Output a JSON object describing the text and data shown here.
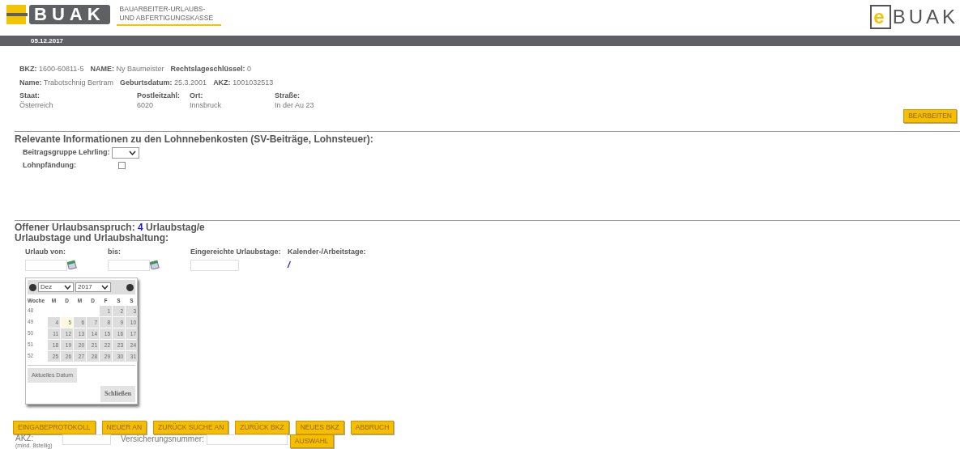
{
  "header": {
    "logo_text": "BUAK",
    "org_line1": "BAUARBEITER-URLAUBS-",
    "org_line2": "UND ABFERTIGUNGSKASSE",
    "ebuak_e": "e",
    "ebuak_text": "BUAK",
    "date": "05.12.2017"
  },
  "info_lines": [
    [
      {
        "label": "BKZ:",
        "value": "1600-60811-5"
      },
      {
        "label": "NAME:",
        "value": "Ny Baumeister"
      },
      {
        "label": "Rechtslageschlüssel:",
        "value": "0"
      }
    ],
    [
      {
        "label": "Name:",
        "value": "Trabotschnig Bertram"
      },
      {
        "label": "Geburtsdatum:",
        "value": "25.3.2001"
      },
      {
        "label": "AKZ:",
        "value": "1001032513"
      }
    ]
  ],
  "address": [
    {
      "label": "Staat:",
      "value": "Österreich"
    },
    {
      "label": "Postleitzahl:",
      "value": "6020"
    },
    {
      "label": "Ort:",
      "value": "Innsbruck"
    },
    {
      "label": "Straße:",
      "value": "In der Au 23"
    }
  ],
  "edit_button": "BEARBEITEN",
  "lohn": {
    "heading": "Relevante Informationen zu den Lohnnebenkosten (SV-Beiträge, Lohnsteuer):",
    "beitrag_label": "Beitragsgruppe Lehrling:",
    "pfaendung_label": "Lohnpfändung:",
    "pfaendung_checked": false
  },
  "urlaub": {
    "open_prefix": "Offener Urlaubsanspruch:",
    "open_days": "4",
    "open_suffix": "Urlaubstag/e",
    "heading": "Urlaubstage und Urlaubshaltung:",
    "von_label": "Urlaub von:",
    "bis_label": "bis:",
    "eingereicht_label": "Eingereichte Urlaubstage:",
    "kalender_label": "Kalender-/Arbeitstage:",
    "kalender_value": "/"
  },
  "calendar": {
    "month": "Dez",
    "year": "2017",
    "week_header": "Woche",
    "weekday_headers": [
      "M",
      "D",
      "M",
      "D",
      "F",
      "S",
      "S"
    ],
    "weeks": [
      {
        "week": "48",
        "days": [
          {
            "kind": "blank"
          },
          {
            "kind": "blank"
          },
          {
            "kind": "blank"
          },
          {
            "kind": "blank"
          },
          {
            "d": "1",
            "today": false
          },
          {
            "d": "2",
            "today": false
          },
          {
            "d": "3",
            "today": false
          }
        ]
      },
      {
        "week": "49",
        "days": [
          {
            "d": "4",
            "today": false
          },
          {
            "d": "5",
            "today": true
          },
          {
            "d": "6",
            "today": false
          },
          {
            "d": "7",
            "today": false
          },
          {
            "d": "8",
            "today": false
          },
          {
            "d": "9",
            "today": false
          },
          {
            "d": "10",
            "today": false
          }
        ]
      },
      {
        "week": "50",
        "days": [
          {
            "d": "11",
            "today": false
          },
          {
            "d": "12",
            "today": false
          },
          {
            "d": "13",
            "today": false
          },
          {
            "d": "14",
            "today": false
          },
          {
            "d": "15",
            "today": false
          },
          {
            "d": "16",
            "today": false
          },
          {
            "d": "17",
            "today": false
          }
        ]
      },
      {
        "week": "51",
        "days": [
          {
            "d": "18",
            "today": false
          },
          {
            "d": "19",
            "today": false
          },
          {
            "d": "20",
            "today": false
          },
          {
            "d": "21",
            "today": false
          },
          {
            "d": "22",
            "today": false
          },
          {
            "d": "23",
            "today": false
          },
          {
            "d": "24",
            "today": false
          }
        ]
      },
      {
        "week": "52",
        "days": [
          {
            "d": "25",
            "today": false
          },
          {
            "d": "26",
            "today": false
          },
          {
            "d": "27",
            "today": false
          },
          {
            "d": "28",
            "today": false
          },
          {
            "d": "29",
            "today": false
          },
          {
            "d": "30",
            "today": false
          },
          {
            "d": "31",
            "today": false
          }
        ]
      }
    ],
    "today_button": "Aktuelles Datum",
    "close_button": "Schließen"
  },
  "action_buttons": [
    "EINGABEPROTOKOLL",
    "NEUER AN",
    "ZURÜCK SUCHE AN",
    "ZURÜCK BKZ",
    "NEUES BKZ",
    "ABBRUCH"
  ],
  "search": {
    "akz_label": "AKZ:",
    "akz_hint": "(mind. 8stellig)",
    "vn_label": "Versicherungsnummer:",
    "button": "AUSWAHL"
  }
}
